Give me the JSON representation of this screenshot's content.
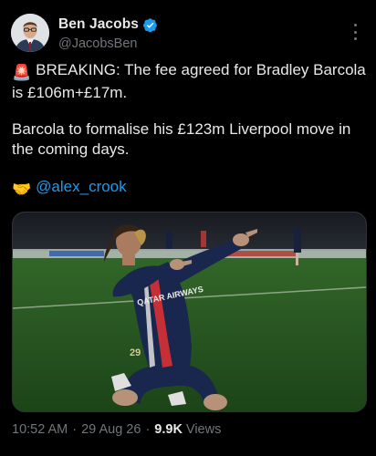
{
  "author": {
    "display_name": "Ben Jacobs",
    "handle": "@JacobsBen",
    "verified": true
  },
  "tweet": {
    "line1_emoji": "🚨",
    "line1_text": "BREAKING: The fee agreed for Bradley Barcola is £106m+£17m.",
    "line2_text": "Barcola to formalise his £123m Liverpool move in the coming days.",
    "line3_emoji": "🤝",
    "mention": "@alex_crook"
  },
  "media": {
    "shirt_sponsor": "QATAR AIRWAYS",
    "shirt_number": "29"
  },
  "meta": {
    "time": "10:52 AM",
    "separator": "·",
    "date": "29 Aug 26",
    "views_count": "9.9K",
    "views_label": "Views"
  },
  "colors": {
    "background": "#000000",
    "text": "#e7e9ea",
    "secondary": "#71767b",
    "link": "#1d9bf0",
    "verified": "#1d9bf0"
  },
  "icons": {
    "verified": "verified-badge-icon",
    "more": "more-vertical-icon"
  }
}
